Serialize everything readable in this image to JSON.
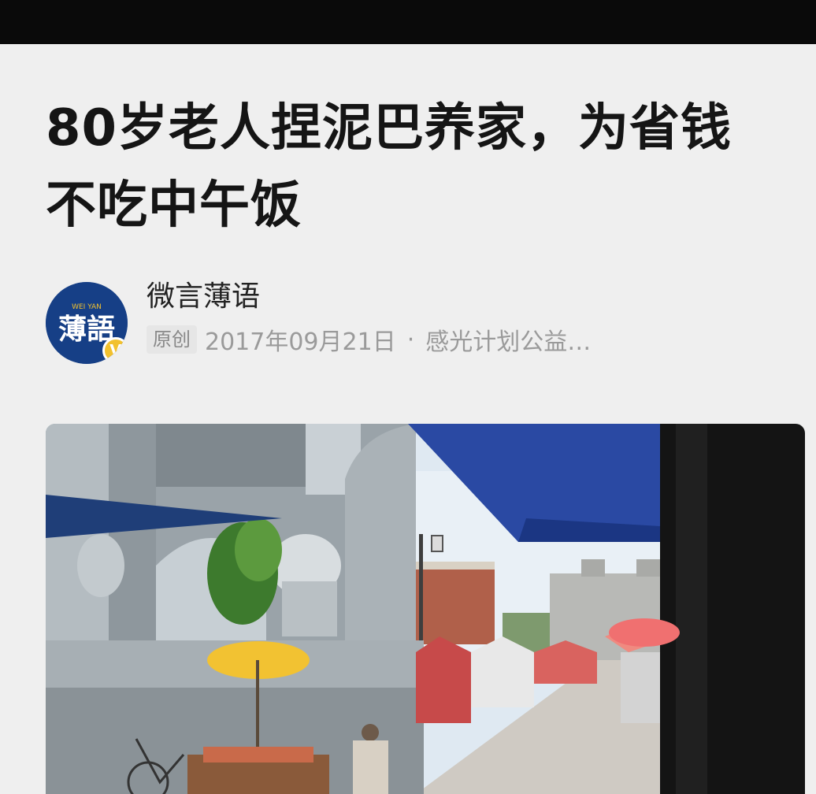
{
  "article": {
    "title_line1": "80岁老人捏泥巴养家，为省钱",
    "title_line2": "不吃中午饭",
    "author": {
      "name": "微言薄语",
      "avatar_icon": "weiyan-logo-icon",
      "avatar_text": "薄語",
      "avatar_subtext": "WEI YAN",
      "verified_icon": "verified-v-icon",
      "verified_text": "V"
    },
    "meta": {
      "original_tag": "原创",
      "date": "2017年09月21日",
      "separator": "·",
      "source": "感光计划公益…"
    },
    "photo": {
      "icon": "street-market-photo"
    }
  },
  "colors": {
    "top_bar": "#0a0a0a",
    "background": "#efefef",
    "title": "#151515",
    "meta": "#9a9a9a",
    "avatar": "#163f86",
    "badge": "#f2c12e"
  }
}
